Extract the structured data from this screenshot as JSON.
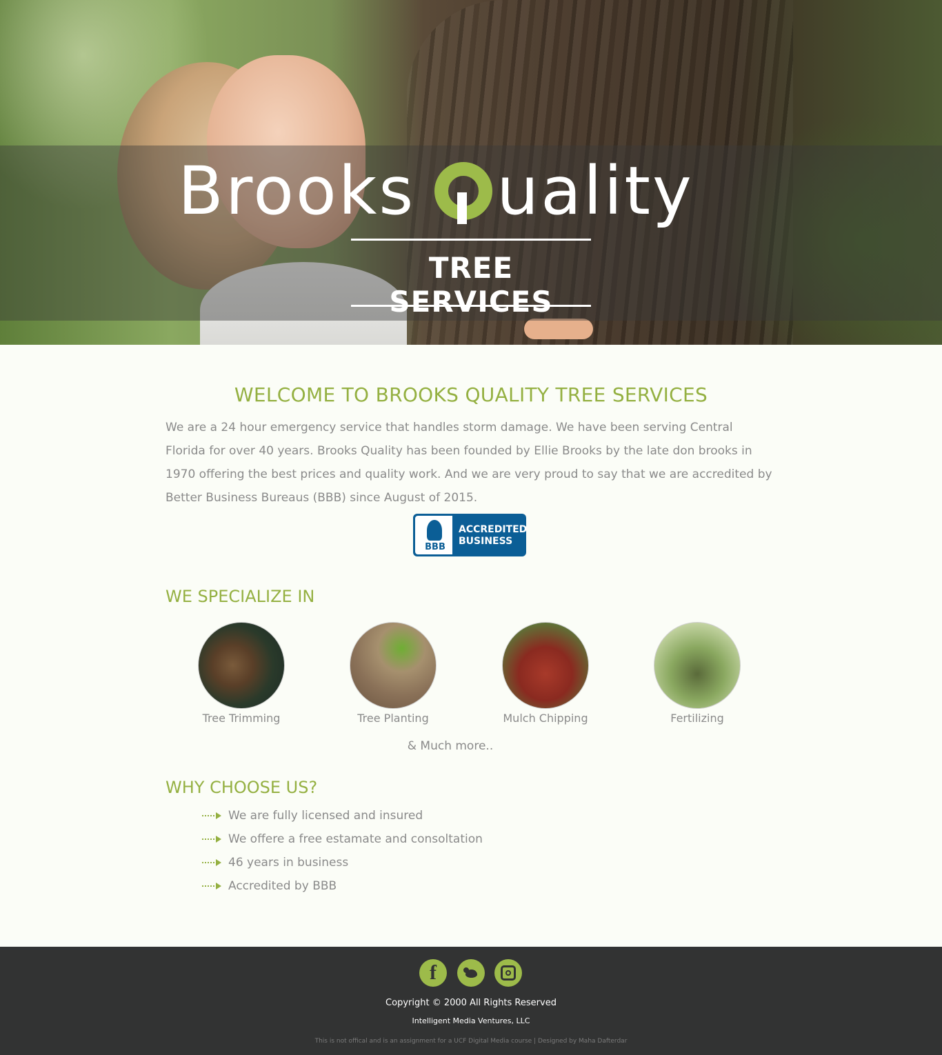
{
  "hero": {
    "brand_word1": "Brooks",
    "brand_word2_rest": "uality",
    "subtitle": "TREE SERVICES"
  },
  "welcome": {
    "title": "WELCOME TO BROOKS QUALITY TREE SERVICES",
    "text": "We are a 24 hour emergency service that handles storm damage. We have been serving Central Florida for over 40 years. Brooks Quality has been founded by Ellie Brooks by the late don brooks in 1970 offering the best prices and quality work. And we are very proud to say that we are accredited by Better Business Bureaus (BBB) since August of 2015."
  },
  "bbb_badge": {
    "logo_text": "BBB",
    "line1": "ACCREDITED",
    "line2": "BUSINESS"
  },
  "specialize": {
    "title": "WE SPECIALIZE IN",
    "services": [
      {
        "label": "Tree Trimming"
      },
      {
        "label": "Tree Planting"
      },
      {
        "label": "Mulch Chipping"
      },
      {
        "label": "Fertilizing"
      }
    ],
    "more": "& Much more.."
  },
  "why": {
    "title": "WHY CHOOSE US?",
    "items": [
      "We are fully licensed and insured",
      "We offere a free estamate and consoltation",
      "46 years in business",
      "Accredited by BBB"
    ]
  },
  "footer": {
    "social": [
      "facebook-icon",
      "twitter-icon",
      "instagram-icon"
    ],
    "facebook_glyph": "f",
    "copyright": "Copyright © 2000 All Rights Reserved",
    "company": "Intelligent Media Ventures, LLC",
    "disclaimer": "This is not offical and is an assignment for a UCF Digital Media course | Designed by Maha Dafterdar"
  },
  "colors": {
    "accent": "#94b041",
    "footer_bg": "#323333",
    "bbb_blue": "#0b5e96"
  }
}
